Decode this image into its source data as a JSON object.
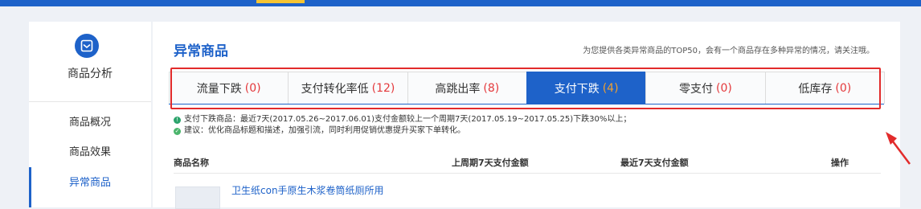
{
  "sidebar": {
    "icon": "inbox-icon",
    "title": "商品分析",
    "items": [
      {
        "label": "商品概况"
      },
      {
        "label": "商品效果"
      },
      {
        "label": "异常商品",
        "active": true
      }
    ]
  },
  "main": {
    "title": "异常商品",
    "note": "为您提供各类异常商品的TOP50，会有一个商品存在多种异常的情况，请关注哦。",
    "tabs": [
      {
        "label": "流量下跌",
        "count": "(0)"
      },
      {
        "label": "支付转化率低",
        "count": "(12)"
      },
      {
        "label": "高跳出率",
        "count": "(8)"
      },
      {
        "label": "支付下跌",
        "count": "(4)",
        "active": true
      },
      {
        "label": "零支付",
        "count": "(0)"
      },
      {
        "label": "低库存",
        "count": "(0)"
      }
    ],
    "info": {
      "line1": "支付下跌商品：最近7天(2017.05.26~2017.06.01)支付金额较上一个周期7天(2017.05.19~2017.05.25)下跌30%以上；",
      "line2": "建议：优化商品标题和描述，加强引流，同时利用促销优惠提升买家下单转化。"
    },
    "table": {
      "headers": [
        "商品名称",
        "上周期7天支付金额",
        "最近7天支付金额",
        "操作"
      ],
      "rows": [
        {
          "name": "卫生纸con手原生木浆卷筒纸厕所用"
        }
      ]
    }
  },
  "colors": {
    "brand": "#1e62c9",
    "accent": "#f5c433",
    "highlight": "#e22b2b",
    "count": "#e4393c"
  }
}
